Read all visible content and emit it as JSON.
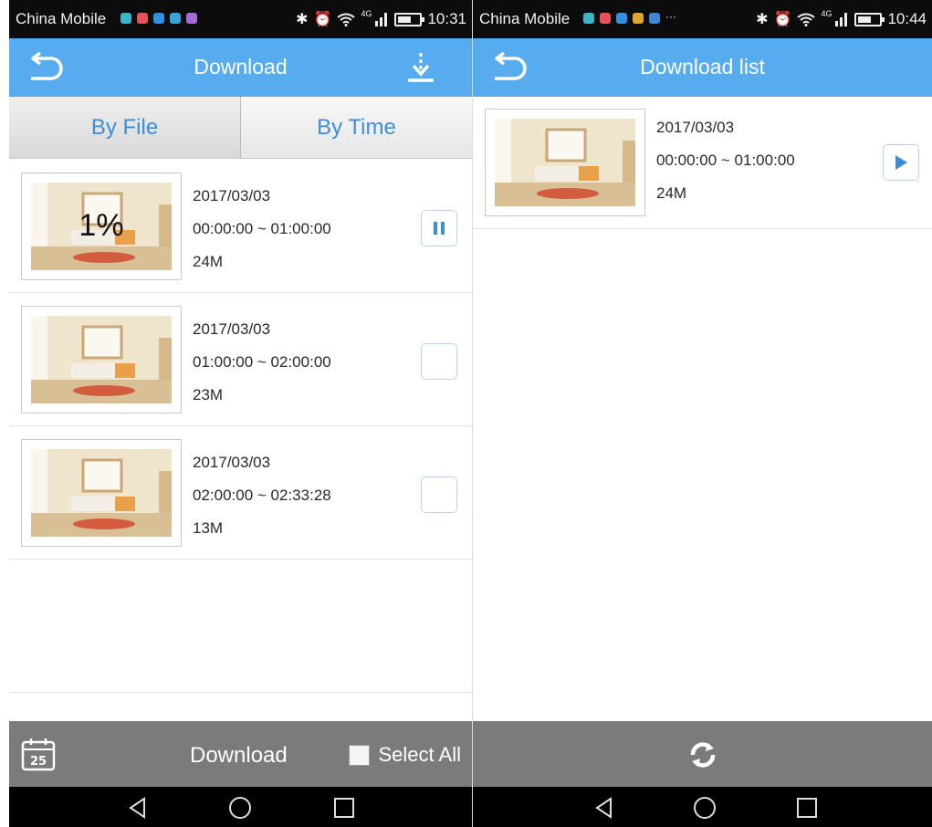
{
  "colors": {
    "accent": "#56acee",
    "status_bar": "#0c0c0c",
    "bottom_bar": "#7b7b7b",
    "tab_text": "#3b8fd9"
  },
  "left": {
    "status": {
      "carrier": "China Mobile",
      "network": "4G",
      "time": "10:31"
    },
    "title": "Download",
    "tabs": [
      {
        "label": "By File"
      },
      {
        "label": "By Time"
      }
    ],
    "files": [
      {
        "date": "2017/03/03",
        "range": "00:00:00 ~ 01:00:00",
        "size": "24M",
        "progress": "1%",
        "state": "downloading"
      },
      {
        "date": "2017/03/03",
        "range": "01:00:00 ~ 02:00:00",
        "size": "23M",
        "state": "unchecked"
      },
      {
        "date": "2017/03/03",
        "range": "02:00:00 ~ 02:33:28",
        "size": "13M",
        "state": "unchecked"
      }
    ],
    "bottom": {
      "calendar_day": "25",
      "download_label": "Download",
      "select_all_label": "Select All"
    }
  },
  "right": {
    "status": {
      "carrier": "China Mobile",
      "overflow": "···",
      "network": "4G",
      "time": "10:44"
    },
    "title": "Download list",
    "items": [
      {
        "date": "2017/03/03",
        "range": "00:00:00 ~ 01:00:00",
        "size": "24M"
      }
    ]
  },
  "icons": {
    "back": "back-arrow-icon",
    "download": "download-icon",
    "pause": "pause-icon",
    "play": "play-icon",
    "calendar": "calendar-icon",
    "refresh": "refresh-icon",
    "nav_back": "nav-back-icon",
    "nav_home": "nav-home-icon",
    "nav_recent": "nav-recent-icon"
  }
}
